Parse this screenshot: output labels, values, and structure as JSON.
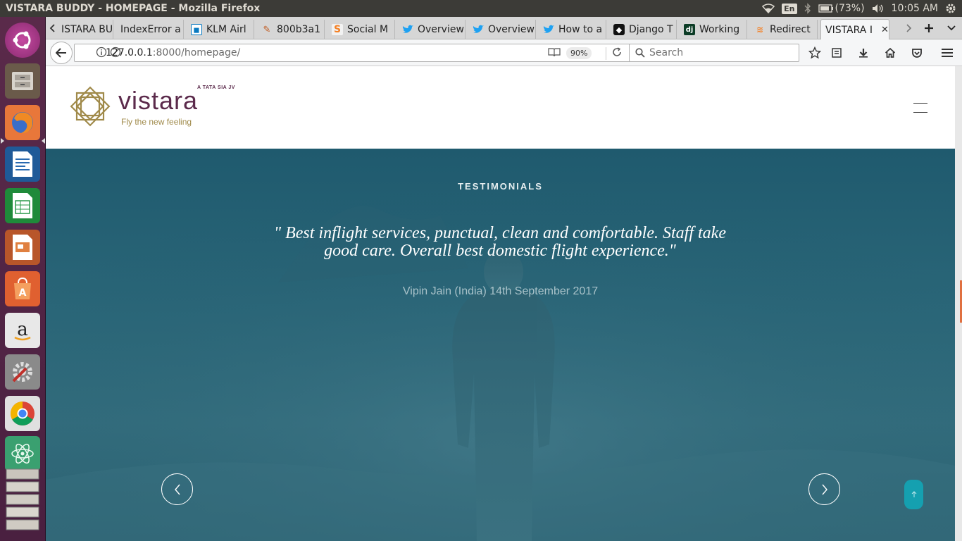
{
  "window": {
    "title": "VISTARA BUDDY - HOMEPAGE - Mozilla Firefox"
  },
  "system_tray": {
    "keyboard": "En",
    "battery": "(73%)",
    "time": "10:05 AM"
  },
  "launcher": {
    "items": [
      "ubuntu-dash-icon",
      "files-icon",
      "firefox-icon",
      "writer-icon",
      "calc-icon",
      "impress-icon",
      "software-center-icon",
      "amazon-icon",
      "system-settings-icon",
      "chrome-icon",
      "atom-icon",
      "workspace-icon"
    ]
  },
  "tabs": [
    {
      "label": "ISTARA BU",
      "icon": "none"
    },
    {
      "label": "IndexError a",
      "icon": "none"
    },
    {
      "label": "KLM Airl",
      "icon": "klm-icon"
    },
    {
      "label": "800b3a1",
      "icon": "feather-icon"
    },
    {
      "label": "Social M",
      "icon": "stackoverflow-icon"
    },
    {
      "label": "Overview",
      "icon": "twitter-icon"
    },
    {
      "label": "Overview",
      "icon": "twitter-icon"
    },
    {
      "label": "How to a",
      "icon": "twitter-icon"
    },
    {
      "label": "Django T",
      "icon": "github-icon"
    },
    {
      "label": "Working",
      "icon": "django-icon"
    },
    {
      "label": "Redirect",
      "icon": "stackoverflow-icon"
    },
    {
      "label": "VISTARA I",
      "icon": "none",
      "active": true
    }
  ],
  "navbar": {
    "url_host": "127.0.0.1",
    "url_rest": ":8000/homepage/",
    "zoom": "90%",
    "search_placeholder": "Search"
  },
  "site": {
    "brand": "vistara",
    "jv_label": "A TATA SIA JV",
    "tagline": "Fly the new feeling",
    "colors": {
      "brand": "#5b2a4b",
      "gold": "#a08a4a",
      "accent": "#15a0b0"
    }
  },
  "testimonials": {
    "section_label": "TESTIMONIALS",
    "quote": "\" Best inflight services, punctual, clean and comfortable. Staff take good care. Overall best domestic flight experience.\"",
    "attribution": "Vipin Jain (India) 14th September 2017"
  }
}
